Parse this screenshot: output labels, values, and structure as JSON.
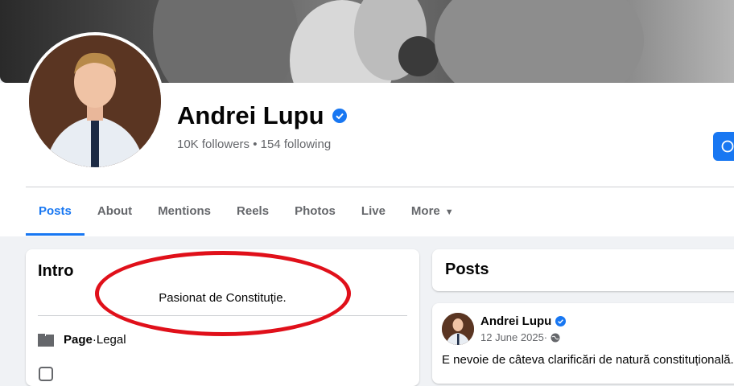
{
  "profile": {
    "name": "Andrei Lupu",
    "verified_icon": "verified-badge-icon",
    "followers": "10K followers",
    "separator": " • ",
    "following": "154 following"
  },
  "tabs": [
    {
      "label": "Posts",
      "active": true
    },
    {
      "label": "About"
    },
    {
      "label": "Mentions"
    },
    {
      "label": "Reels"
    },
    {
      "label": "Photos"
    },
    {
      "label": "Live"
    },
    {
      "label": "More",
      "icon": "caret-down-icon"
    }
  ],
  "intro": {
    "title": "Intro",
    "bio": "Pasionat de Constituție.",
    "page_label": "Page",
    "page_separator": " · ",
    "page_category": "Legal",
    "page_icon": "flag-page-icon"
  },
  "posts_section": {
    "title": "Posts"
  },
  "post": {
    "author": "Andrei Lupu",
    "date": "12 June 2025",
    "date_separator": " · ",
    "audience_icon": "globe-icon",
    "text": "E nevoie de câteva clarificări de natură constituțională."
  },
  "colors": {
    "accent": "#1877f2",
    "annotation": "#e0101a",
    "secondary_text": "#65676b"
  }
}
